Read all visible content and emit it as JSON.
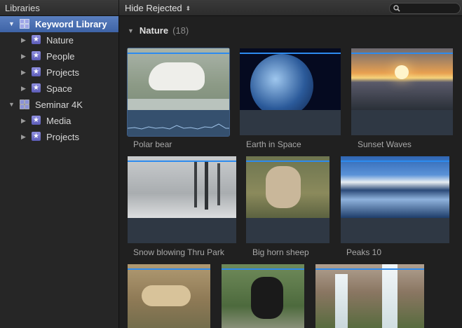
{
  "topbar": {
    "libraries_label": "Libraries",
    "filter_label": "Hide Rejected",
    "filter_arrows": "▲▼"
  },
  "sidebar": {
    "items": [
      {
        "label": "Keyword Library",
        "type": "library",
        "expanded": true,
        "selected": true
      },
      {
        "label": "Nature",
        "type": "keyword",
        "expanded": false
      },
      {
        "label": "People",
        "type": "keyword",
        "expanded": false
      },
      {
        "label": "Projects",
        "type": "keyword",
        "expanded": false
      },
      {
        "label": "Space",
        "type": "keyword",
        "expanded": false
      },
      {
        "label": "Seminar 4K",
        "type": "library",
        "expanded": true
      },
      {
        "label": "Media",
        "type": "keyword",
        "expanded": false
      },
      {
        "label": "Projects",
        "type": "keyword",
        "expanded": false
      }
    ]
  },
  "browser": {
    "group": {
      "name": "Nature",
      "count": "(18)"
    },
    "clips": [
      {
        "name": "Polar bear"
      },
      {
        "name": "Earth in Space"
      },
      {
        "name": "Sunset Waves"
      },
      {
        "name": "Snow blowing Thru Park"
      },
      {
        "name": "Big horn sheep"
      },
      {
        "name": "Peaks 10"
      },
      {
        "name": ""
      },
      {
        "name": ""
      },
      {
        "name": ""
      }
    ]
  },
  "colors": {
    "selection": "#4a70b3",
    "clip_bar": "#2d8bef",
    "clip_bg": "#2f3844"
  }
}
